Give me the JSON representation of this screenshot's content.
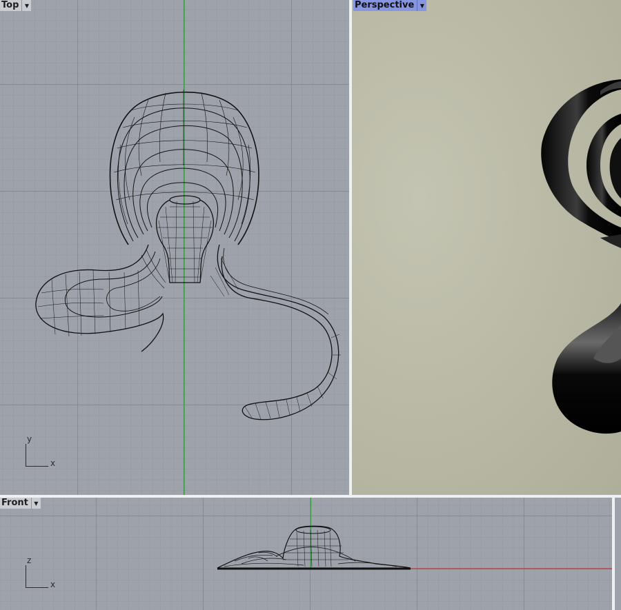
{
  "viewports": {
    "top": {
      "label": "Top",
      "menu_icon": "chevron-down-icon",
      "axis_v": "y",
      "axis_h": "x"
    },
    "perspective": {
      "label": "Perspective",
      "menu_icon": "chevron-down-icon",
      "active": true
    },
    "front": {
      "label": "Front",
      "menu_icon": "chevron-down-icon",
      "axis_v": "z",
      "axis_h": "x"
    }
  },
  "colors": {
    "viewport_bg": "#9ea3ab",
    "perspective_bg": "#b7b7a3",
    "active_label": "#8796e0",
    "y_axis": "#3aa048",
    "x_axis": "#c03030"
  }
}
